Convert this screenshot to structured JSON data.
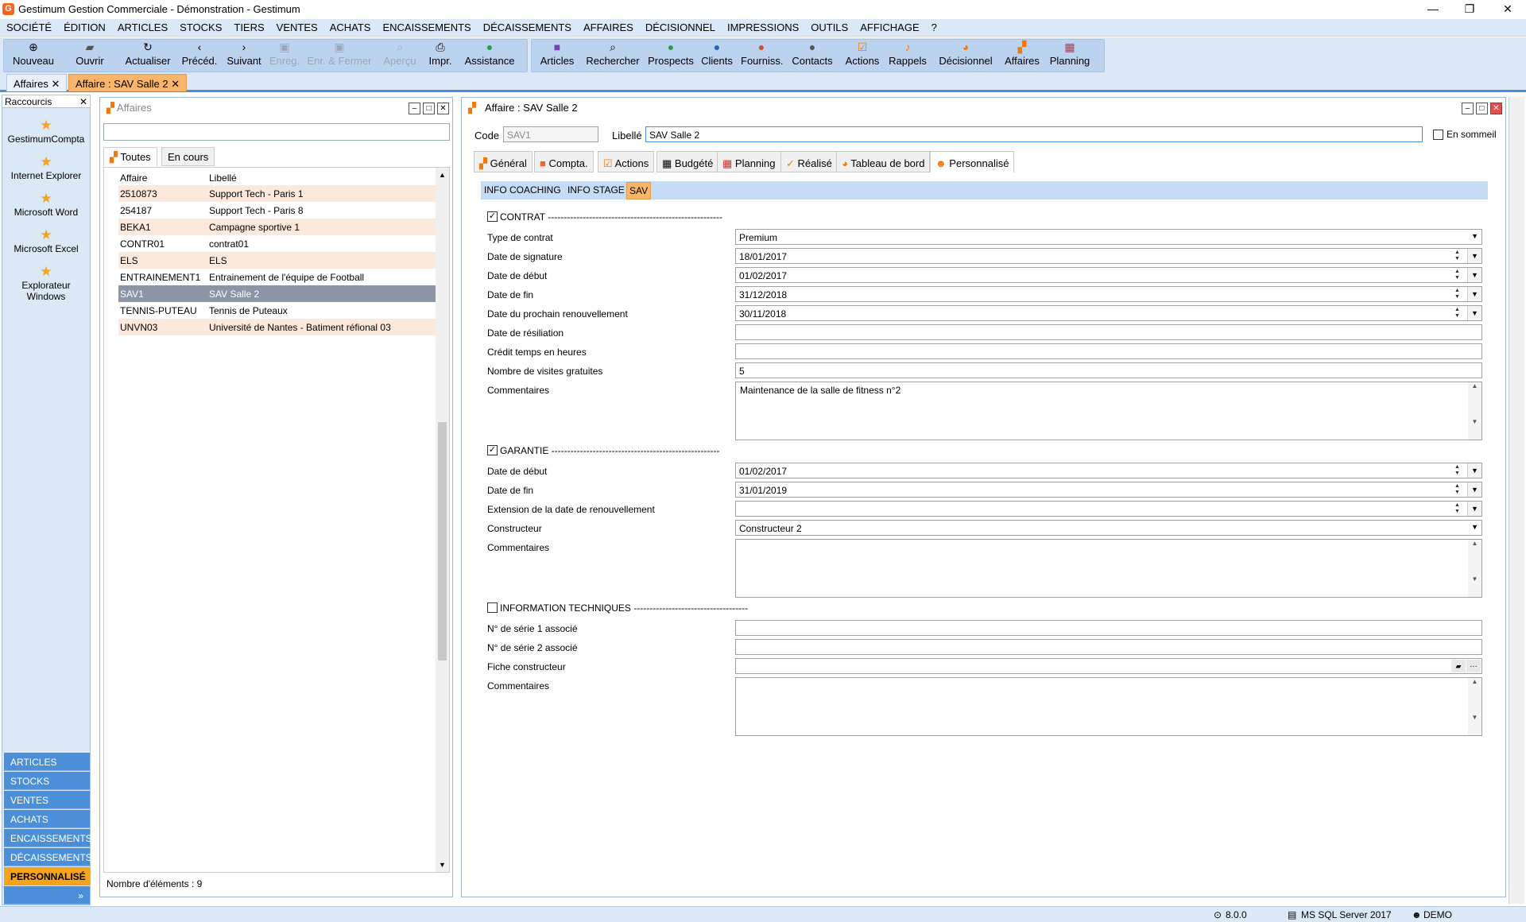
{
  "window": {
    "title": "Gestimum Gestion Commerciale - Démonstration - Gestimum"
  },
  "menu": [
    "SOCIÉTÉ",
    "ÉDITION",
    "ARTICLES",
    "STOCKS",
    "TIERS",
    "VENTES",
    "ACHATS",
    "ENCAISSEMENTS",
    "DÉCAISSEMENTS",
    "AFFAIRES",
    "DÉCISIONNEL",
    "IMPRESSIONS",
    "OUTILS",
    "AFFICHAGE",
    "?"
  ],
  "toolbar": {
    "nouveau": "Nouveau",
    "ouvrir": "Ouvrir",
    "actualiser": "Actualiser",
    "preced": "Précéd.",
    "suivant": "Suivant",
    "enreg": "Enreg.",
    "enr_fermer": "Enr. & Fermer",
    "apercu": "Aperçu",
    "impr": "Impr.",
    "assistance": "Assistance",
    "articles": "Articles",
    "rechercher": "Rechercher",
    "prospects": "Prospects",
    "clients": "Clients",
    "fourniss": "Fourniss.",
    "contacts": "Contacts",
    "actions": "Actions",
    "rappels": "Rappels",
    "decisionnel": "Décisionnel",
    "affaires": "Affaires",
    "planning": "Planning"
  },
  "doc_tabs": [
    {
      "label": "Affaires"
    },
    {
      "label": "Affaire : SAV Salle 2"
    }
  ],
  "shortcuts": {
    "title": "Raccourcis",
    "items": [
      "GestimumCompta",
      "Internet Explorer",
      "Microsoft Word",
      "Microsoft Excel",
      "Explorateur Windows"
    ],
    "categories": [
      "ARTICLES",
      "STOCKS",
      "VENTES",
      "ACHATS",
      "ENCAISSEMENTS",
      "DÉCAISSEMENTS",
      "PERSONNALISÉ"
    ]
  },
  "list": {
    "title": "Affaires",
    "tabs": [
      "Toutes",
      "En cours"
    ],
    "columns": [
      "Affaire",
      "Libellé"
    ],
    "rows": [
      {
        "code": "2510873",
        "label": "Support Tech - Paris 1"
      },
      {
        "code": "254187",
        "label": "Support Tech - Paris 8"
      },
      {
        "code": "BEKA1",
        "label": "Campagne sportive 1"
      },
      {
        "code": "CONTR01",
        "label": "contrat01"
      },
      {
        "code": "ELS",
        "label": "ELS"
      },
      {
        "code": "ENTRAINEMENT1",
        "label": "Entrainement de l'équipe de Football"
      },
      {
        "code": "SAV1",
        "label": "SAV Salle 2"
      },
      {
        "code": "TENNIS-PUTEAU",
        "label": "Tennis de Puteaux"
      },
      {
        "code": "UNVN03",
        "label": "Université de Nantes - Batiment réfional 03"
      }
    ],
    "count_text": "Nombre d'éléments : 9"
  },
  "detail": {
    "title": "Affaire : SAV Salle 2",
    "code_label": "Code",
    "code_value": "SAV1",
    "libelle_label": "Libellé",
    "libelle_value": "SAV Salle 2",
    "sommeil_label": "En sommeil",
    "tabs": [
      "Général",
      "Compta.",
      "Actions",
      "Budgété",
      "Planning",
      "Réalisé",
      "Tableau de bord",
      "Personnalisé"
    ],
    "subtabs": [
      "INFO COACHING",
      "INFO STAGE",
      "SAV"
    ],
    "contrat": {
      "header": "CONTRAT -------------------------------------------------------",
      "type_label": "Type de contrat",
      "type_value": "Premium",
      "signature_label": "Date de signature",
      "signature_value": "18/01/2017",
      "debut_label": "Date de début",
      "debut_value": "01/02/2017",
      "fin_label": "Date de fin",
      "fin_value": "31/12/2018",
      "renouv_label": "Date du prochain renouvellement",
      "renouv_value": "30/11/2018",
      "resiliation_label": "Date de résiliation",
      "credit_label": "Crédit temps en heures",
      "visites_label": "Nombre de visites gratuites",
      "visites_value": "5",
      "comment_label": "Commentaires",
      "comment_value": "Maintenance de la salle de fitness n°2"
    },
    "garantie": {
      "header": "GARANTIE -----------------------------------------------------",
      "debut_label": "Date de début",
      "debut_value": "01/02/2017",
      "fin_label": "Date de fin",
      "fin_value": "31/01/2019",
      "ext_label": "Extension de la date de renouvellement",
      "constructeur_label": "Constructeur",
      "constructeur_value": "Constructeur 2",
      "comment_label": "Commentaires"
    },
    "tech": {
      "header": "INFORMATION TECHNIQUES ------------------------------------",
      "serie1_label": "N° de série 1 associé",
      "serie2_label": "N° de série 2 associé",
      "fiche_label": "Fiche constructeur",
      "comment_label": "Commentaires"
    }
  },
  "status": {
    "version": "8.0.0",
    "db": "MS SQL Server 2017",
    "user": "DEMO"
  },
  "colors": {
    "accent": "#4a8fd8",
    "active_tab": "#f9b66a",
    "toolbar_bg": "#dbe8f7",
    "row_alt": "#fde9dc",
    "row_selected": "#8b95a6"
  }
}
